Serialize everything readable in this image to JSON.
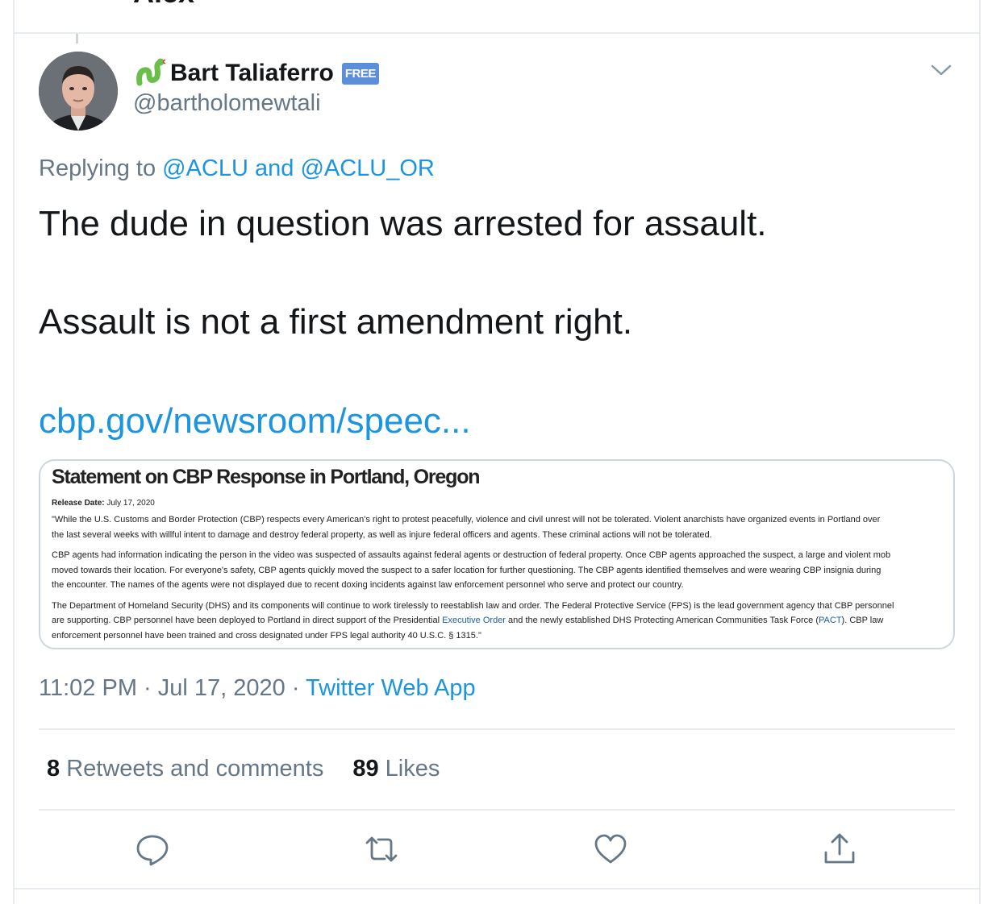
{
  "previous_tweet_tail": "Alex",
  "author": {
    "display_name": "Bart Taliaferro",
    "badge": "FREE",
    "handle": "@bartholomewtali"
  },
  "reply_context": {
    "prefix": "Replying to ",
    "mention1": "@ACLU",
    "joiner": " and ",
    "mention2": "@ACLU_OR"
  },
  "tweet": {
    "line1": "The dude in question was arrested for assault.",
    "line2": "Assault is not a first amendment right.",
    "link": "cbp.gov/newsroom/speec..."
  },
  "card": {
    "title": "Statement on CBP Response in Portland, Oregon",
    "release_label": "Release Date:",
    "release_date": " July 17, 2020",
    "p1": "\"While the U.S. Customs and Border Protection (CBP) respects every American's right to protest peacefully, violence and civil unrest will not be tolerated.  Violent anarchists have organized events in Portland over\nthe last several weeks with willful intent to damage and destroy federal property, as well as injure federal officers and agents. These criminal actions will not be tolerated.",
    "p2": "CBP agents had information indicating the person in the video was suspected of assaults against federal agents or destruction of federal property.  Once CBP agents approached the suspect, a large and violent mob\nmoved towards their location.  For everyone's safety, CBP agents quickly moved the suspect to a safer location for further questioning.  The CBP agents identified themselves and were wearing CBP insignia during\nthe encounter. The names of the agents were not displayed due to recent doxing incidents against law enforcement personnel who serve and protect our country.",
    "p3_a": "The Department of Homeland Security (DHS) and its components will continue to work tirelessly to reestablish law and order.  The Federal Protective Service (FPS) is the lead government agency that CBP personnel\nare supporting.  CBP personnel have been deployed to Portland in direct support of the Presidential ",
    "p3_link1": "Executive Order",
    "p3_b": " and the newly established DHS Protecting American Communities Task Force (",
    "p3_link2": "PACT",
    "p3_c": ").  CBP law\nenforcement personnel have been trained and cross designated under FPS legal authority 40 U.S.C. § 1315.\""
  },
  "meta": {
    "time": "11:02 PM",
    "sep1": " · ",
    "date": "Jul 17, 2020",
    "sep2": " · ",
    "source": "Twitter Web App"
  },
  "stats": {
    "retweets_count": "8",
    "retweets_label": " Retweets and comments",
    "likes_count": "89",
    "likes_label": " Likes"
  },
  "icons": {
    "reply": "reply-icon",
    "retweet": "retweet-icon",
    "like": "heart-icon",
    "share": "share-icon",
    "menu": "chevron-down-icon"
  },
  "colors": {
    "link": "#1b95e0",
    "muted": "#657786",
    "text": "#14171a",
    "border": "#e6ecf0"
  }
}
